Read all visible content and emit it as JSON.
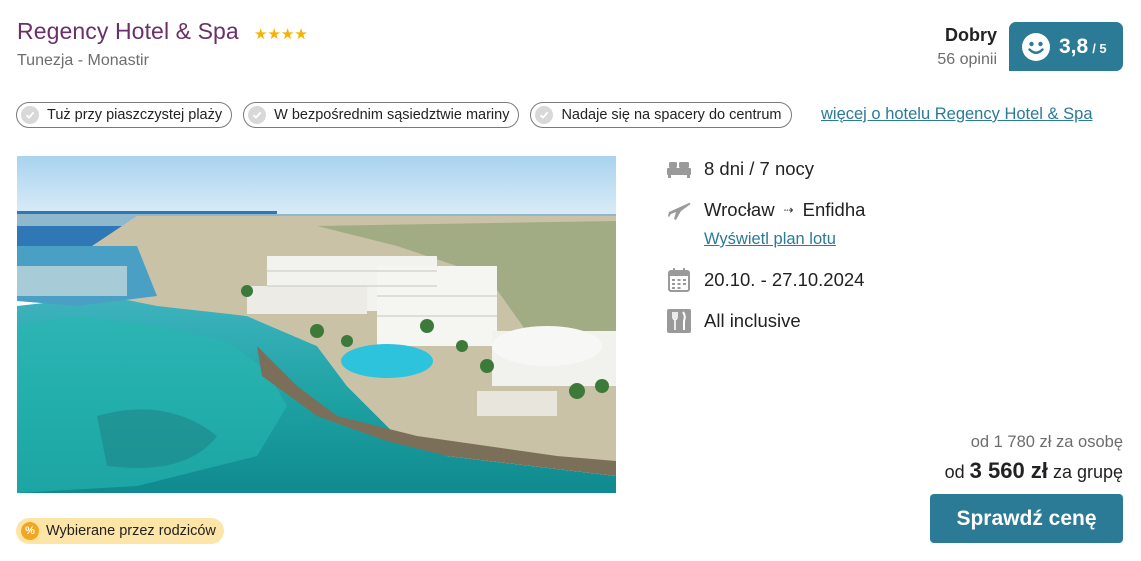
{
  "hotel": {
    "name": "Regency Hotel & Spa",
    "stars": "★★★★",
    "location": "Tunezja - Monastir"
  },
  "rating": {
    "label": "Dobry",
    "reviews": "56 opinii",
    "score": "3,8",
    "max": "/ 5"
  },
  "tags": [
    "Tuż przy piaszczystej plaży",
    "W bezpośrednim sąsiedztwie mariny",
    "Nadaje się na spacery do centrum"
  ],
  "more_link": "więcej o hotelu Regency Hotel & Spa",
  "trip": {
    "duration": "8 dni / 7 nocy",
    "departure": "Wrocław",
    "arrival": "Enfidha",
    "flight_link": "Wyświetl plan lotu",
    "dates": "20.10. - 27.10.2024",
    "board": "All inclusive"
  },
  "price": {
    "per_person": "od 1 780 zł za osobę",
    "group_prefix": "od",
    "group_amount": "3 560 zł",
    "group_suffix": "za grupę"
  },
  "button_label": "Sprawdź cenę",
  "badge": "Wybierane przez rodziców",
  "colors": {
    "accent": "#2b7a96",
    "hotel_name": "#6b2f6b",
    "stars": "#f5b301",
    "badge_bg": "#fde4a7"
  }
}
